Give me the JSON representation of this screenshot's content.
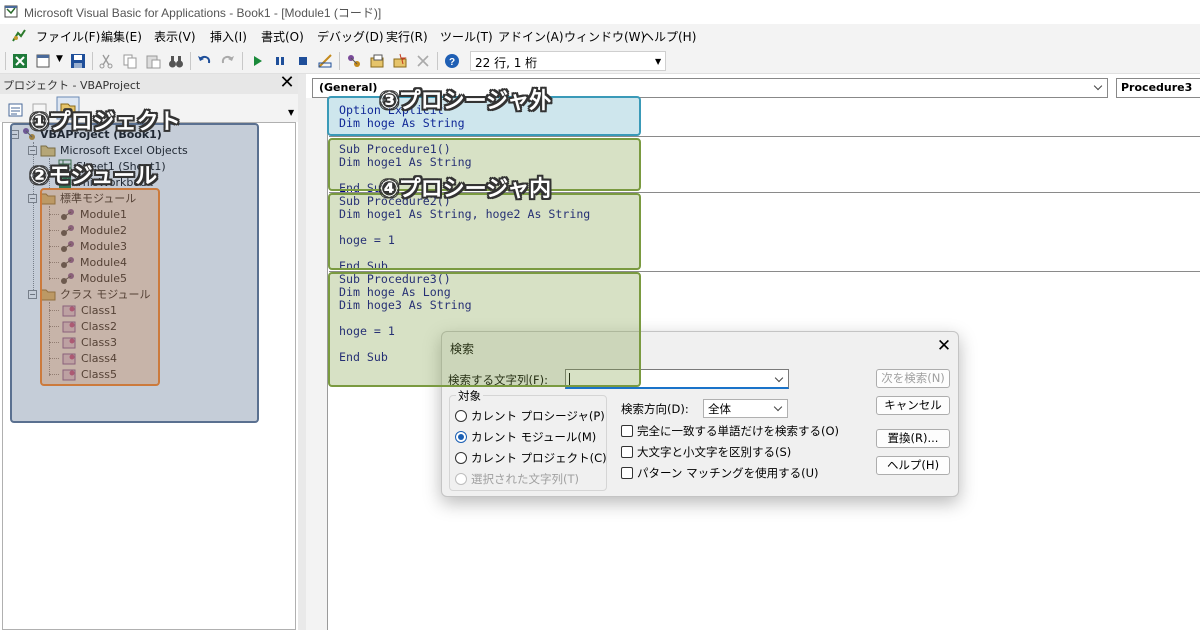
{
  "window": {
    "title": "Microsoft Visual Basic for Applications - Book1 - [Module1 (コード)]"
  },
  "menu": [
    "ファイル(F)",
    "編集(E)",
    "表示(V)",
    "挿入(I)",
    "書式(O)",
    "デバッグ(D)",
    "実行(R)",
    "ツール(T)",
    "アドイン(A)",
    "ウィンドウ(W)",
    "ヘルプ(H)"
  ],
  "toolbar": {
    "position": "22 行, 1 桁"
  },
  "project": {
    "title": "プロジェクト - VBAProject",
    "close_glyph": "✕",
    "tree": {
      "root": "VBAProject (Book1)",
      "excel_objects": "Microsoft Excel Objects",
      "sheet": "Sheet1 (Sheet1)",
      "workbook": "ThisWorkbook",
      "std_modules": "標準モジュール",
      "modules": [
        "Module1",
        "Module2",
        "Module3",
        "Module4",
        "Module5"
      ],
      "class_modules": "クラス モジュール",
      "classes": [
        "Class1",
        "Class2",
        "Class3",
        "Class4",
        "Class5"
      ]
    }
  },
  "code": {
    "object_combo": "(General)",
    "proc_combo": "Procedure3",
    "lines": [
      "Option Explicit",
      "Dim hoge As String",
      "Sub Procedure1()",
      "Dim hoge1 As String",
      "End Sub",
      "Sub Procedure2()",
      "Dim hoge1 As String, hoge2 As String",
      "hoge = 1",
      "End Sub",
      "Sub Procedure3()",
      "Dim hoge As Long",
      "Dim hoge3 As String",
      "hoge = 1",
      "End Sub"
    ]
  },
  "annotations": {
    "project": "①プロジェクト",
    "module": "②モジュール",
    "outside": "③プロシージャ外",
    "inside": "④プロシージャ内",
    "colors": {
      "project": "#5a7090",
      "module": "#cc7a3c",
      "outside": "#3a9ab8",
      "inside": "#7a9a40"
    }
  },
  "dialog": {
    "title": "検索",
    "close_glyph": "✕",
    "find_label": "検索する文字列(F):",
    "find_value": "",
    "scope_label": "対象",
    "scope_options": [
      "カレント プロシージャ(P)",
      "カレント モジュール(M)",
      "カレント プロジェクト(C)",
      "選択された文字列(T)"
    ],
    "scope_selected": 1,
    "direction_label": "検索方向(D):",
    "direction_value": "全体",
    "options": [
      "完全に一致する単語だけを検索する(O)",
      "大文字と小文字を区別する(S)",
      "パターン マッチングを使用する(U)"
    ],
    "buttons": {
      "find_next": "次を検索(N)",
      "cancel": "キャンセル",
      "replace": "置換(R)...",
      "help": "ヘルプ(H)"
    }
  }
}
